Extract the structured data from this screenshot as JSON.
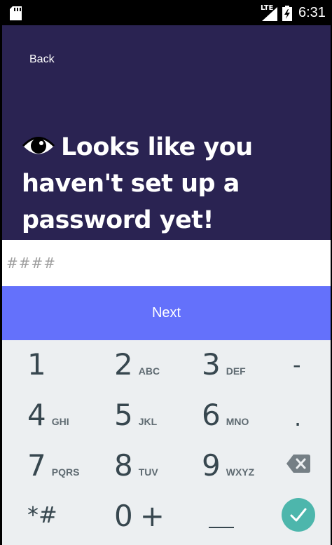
{
  "status_bar": {
    "network": "LTE",
    "time": "6:31"
  },
  "header": {
    "back_label": "Back",
    "title": "Looks like you haven't set up a password yet!",
    "title_icon": "eye-icon",
    "background_color": "#2a2352"
  },
  "password_field": {
    "value": "",
    "placeholder": "####"
  },
  "next_button": {
    "label": "Next",
    "color": "#6471fb"
  },
  "keypad": {
    "keys": [
      {
        "digit": "1",
        "letters": ""
      },
      {
        "digit": "2",
        "letters": "ABC"
      },
      {
        "digit": "3",
        "letters": "DEF"
      },
      {
        "digit": "4",
        "letters": "GHI"
      },
      {
        "digit": "5",
        "letters": "JKL"
      },
      {
        "digit": "6",
        "letters": "MNO"
      },
      {
        "digit": "7",
        "letters": "PQRS"
      },
      {
        "digit": "8",
        "letters": "TUV"
      },
      {
        "digit": "9",
        "letters": "WXYZ"
      },
      {
        "digit": "0",
        "letters": "+"
      }
    ],
    "symbols": {
      "star_hash": "*#",
      "minus": "-",
      "dot": "."
    },
    "delete_icon": "backspace-icon",
    "done_icon": "checkmark-icon",
    "done_color": "#4db6ac"
  }
}
